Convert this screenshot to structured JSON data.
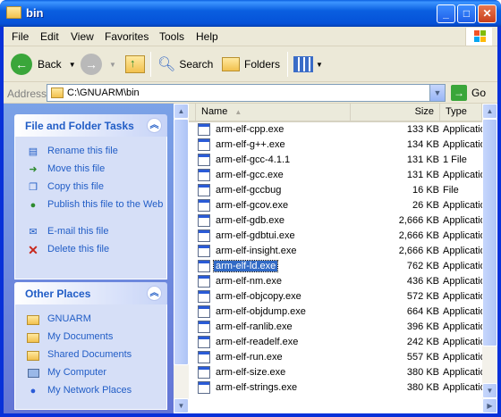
{
  "window": {
    "title": "bin"
  },
  "menu": [
    "File",
    "Edit",
    "View",
    "Favorites",
    "Tools",
    "Help"
  ],
  "toolbar": {
    "back": "Back",
    "search": "Search",
    "folders": "Folders"
  },
  "address": {
    "label": "Address",
    "value": "C:\\GNUARM\\bin",
    "go": "Go"
  },
  "tasks": {
    "file_title": "File and Folder Tasks",
    "file_items": [
      "Rename this file",
      "Move this file",
      "Copy this file",
      "Publish this file to the Web",
      "E-mail this file",
      "Delete this file"
    ],
    "other_title": "Other Places",
    "other_items": [
      "GNUARM",
      "My Documents",
      "Shared Documents",
      "My Computer",
      "My Network Places"
    ]
  },
  "columns": {
    "name": "Name",
    "size": "Size",
    "type": "Type"
  },
  "files": [
    {
      "name": "arm-elf-cpp.exe",
      "size": "133 KB",
      "type": "Application"
    },
    {
      "name": "arm-elf-g++.exe",
      "size": "134 KB",
      "type": "Application"
    },
    {
      "name": "arm-elf-gcc-4.1.1",
      "size": "131 KB",
      "type": "1 File"
    },
    {
      "name": "arm-elf-gcc.exe",
      "size": "131 KB",
      "type": "Application"
    },
    {
      "name": "arm-elf-gccbug",
      "size": "16 KB",
      "type": "File"
    },
    {
      "name": "arm-elf-gcov.exe",
      "size": "26 KB",
      "type": "Application"
    },
    {
      "name": "arm-elf-gdb.exe",
      "size": "2,666 KB",
      "type": "Application"
    },
    {
      "name": "arm-elf-gdbtui.exe",
      "size": "2,666 KB",
      "type": "Application"
    },
    {
      "name": "arm-elf-insight.exe",
      "size": "2,666 KB",
      "type": "Application"
    },
    {
      "name": "arm-elf-ld.exe",
      "size": "762 KB",
      "type": "Application",
      "selected": true
    },
    {
      "name": "arm-elf-nm.exe",
      "size": "436 KB",
      "type": "Application"
    },
    {
      "name": "arm-elf-objcopy.exe",
      "size": "572 KB",
      "type": "Application"
    },
    {
      "name": "arm-elf-objdump.exe",
      "size": "664 KB",
      "type": "Application"
    },
    {
      "name": "arm-elf-ranlib.exe",
      "size": "396 KB",
      "type": "Application"
    },
    {
      "name": "arm-elf-readelf.exe",
      "size": "242 KB",
      "type": "Application"
    },
    {
      "name": "arm-elf-run.exe",
      "size": "557 KB",
      "type": "Application"
    },
    {
      "name": "arm-elf-size.exe",
      "size": "380 KB",
      "type": "Application"
    },
    {
      "name": "arm-elf-strings.exe",
      "size": "380 KB",
      "type": "Application"
    }
  ]
}
